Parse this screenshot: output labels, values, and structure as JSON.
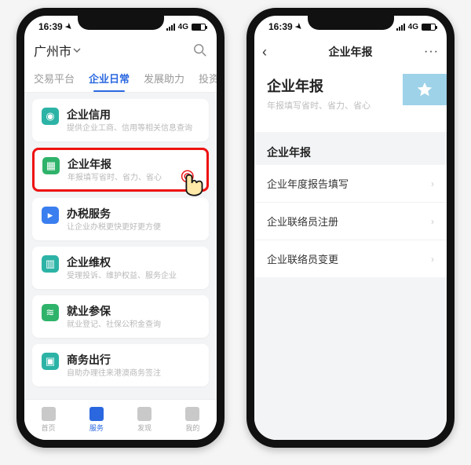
{
  "status": {
    "time": "16:39",
    "network": "4G"
  },
  "phone1": {
    "city": "广州市",
    "tabs": [
      "交易平台",
      "企业日常",
      "发展助力",
      "投资项"
    ],
    "activeTab": 1,
    "cards": [
      {
        "title": "企业信用",
        "sub": "提供企业工商、信用等相关信息查询",
        "color": "teal"
      },
      {
        "title": "企业年报",
        "sub": "年报填写省时、省力、省心",
        "color": "green",
        "highlight": true
      },
      {
        "title": "办税服务",
        "sub": "让企业办税更快更好更方便",
        "color": "blue"
      },
      {
        "title": "企业维权",
        "sub": "受理投诉、维护权益、服务企业",
        "color": "teal"
      },
      {
        "title": "就业参保",
        "sub": "就业登记、社保公积金查询",
        "color": "green"
      },
      {
        "title": "商务出行",
        "sub": "自助办理往来港澳商务签注",
        "color": "teal"
      }
    ],
    "bottomTabs": [
      "首页",
      "服务",
      "发现",
      "我的"
    ],
    "bottomActive": 1
  },
  "phone2": {
    "navTitle": "企业年报",
    "heroTitle": "企业年报",
    "heroSub": "年报填写省时、省力、省心",
    "sectionTitle": "企业年报",
    "rows": [
      "企业年度报告填写",
      "企业联络员注册",
      "企业联络员变更"
    ]
  }
}
